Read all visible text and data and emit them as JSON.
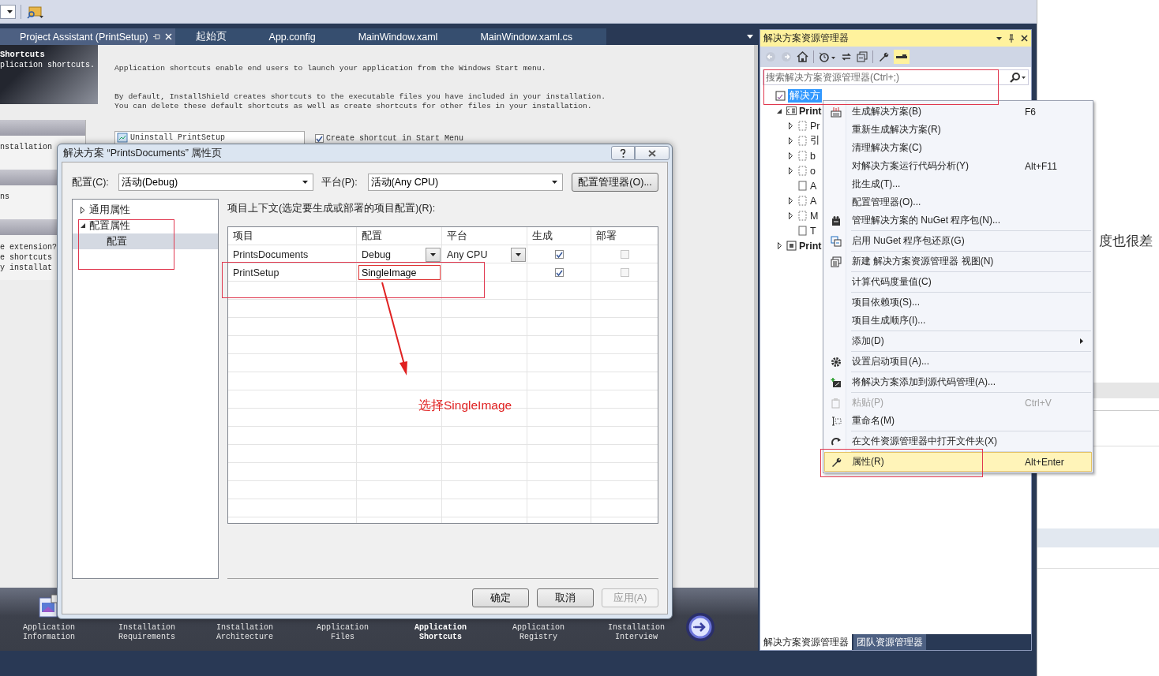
{
  "document_tabs": [
    {
      "label": "Project Assistant (PrintSetup)",
      "selected": true
    },
    {
      "label": "起始页",
      "selected": false
    },
    {
      "label": "App.config",
      "selected": false
    },
    {
      "label": "MainWindow.xaml",
      "selected": false
    },
    {
      "label": "MainWindow.xaml.cs",
      "selected": false
    }
  ],
  "assistant": {
    "sidebar_title": "Shortcuts",
    "sidebar_subtitle": "plication shortcuts.",
    "sidebar_items": [
      "nstallation",
      "ns"
    ],
    "sidebar_lines": [
      "e extension?",
      "e shortcuts",
      "y installat"
    ],
    "intro": "Application shortcuts enable end users to launch your application from the Windows Start menu.",
    "description": [
      "By default, InstallShield creates shortcuts to the executable files you have included in your installation.",
      "You can delete these default shortcuts as well as create shortcuts for other files in your installation."
    ],
    "shortcuts": [
      "Uninstall PrintSetup"
    ],
    "start_menu_option": {
      "label": "Create shortcut in Start Menu",
      "checked": true
    }
  },
  "nav": [
    {
      "label": "Application Information",
      "selected": false
    },
    {
      "label": "Installation Requirements",
      "selected": false
    },
    {
      "label": "Installation Architecture",
      "selected": false
    },
    {
      "label": "Application Files",
      "selected": false
    },
    {
      "label": "Application Shortcuts",
      "selected": true
    },
    {
      "label": "Application Registry",
      "selected": false
    },
    {
      "label": "Installation Interview",
      "selected": false
    }
  ],
  "dialog": {
    "title": "解决方案 “PrintsDocuments” 属性页",
    "config_label": "配置(C):",
    "config_value": "活动(Debug)",
    "platform_label": "平台(P):",
    "platform_value": "活动(Any CPU)",
    "manager_button": "配置管理器(O)...",
    "tree": [
      {
        "label": "通用属性",
        "expanded": false,
        "selected": false
      },
      {
        "label": "配置属性",
        "expanded": true,
        "selected": false,
        "children": [
          {
            "label": "配置",
            "selected": true
          }
        ]
      }
    ],
    "context_label": "项目上下文(选定要生成或部署的项目配置)(R):",
    "columns": [
      "项目",
      "配置",
      "平台",
      "生成",
      "部署"
    ],
    "rows": [
      {
        "project": "PrintsDocuments",
        "configuration": "Debug",
        "editing": false,
        "platform": "Any CPU",
        "build": true,
        "deploy": false
      },
      {
        "project": "PrintSetup",
        "configuration": "SingleImage",
        "editing": true,
        "build": true,
        "deploy": false
      }
    ],
    "buttons": [
      {
        "label": "确定",
        "disabled": false
      },
      {
        "label": "取消",
        "disabled": false
      },
      {
        "label": "应用(A)",
        "disabled": true
      }
    ]
  },
  "solution_explorer": {
    "title": "解决方案资源管理器",
    "search_placeholder": "搜索解决方案资源管理器(Ctrl+;)",
    "tree": [
      {
        "label": "解决方",
        "kind": "solution",
        "selected": true,
        "children": [
          {
            "label": "Print",
            "kind": "project",
            "selected": false,
            "expanded": true,
            "children": [
              {
                "label": "Pr",
                "kind": "group",
                "selected": false,
                "expanded": false
              },
              {
                "label": "引",
                "kind": "group",
                "selected": false,
                "expanded": false
              },
              {
                "label": "b",
                "kind": "group",
                "selected": false,
                "expanded": false
              },
              {
                "label": "o",
                "kind": "group",
                "selected": false,
                "expanded": false
              },
              {
                "label": "A",
                "kind": "leaf",
                "selected": false
              },
              {
                "label": "A",
                "kind": "group",
                "selected": false,
                "expanded": false
              },
              {
                "label": "M",
                "kind": "group",
                "selected": false,
                "expanded": false
              },
              {
                "label": "T",
                "kind": "leaf",
                "selected": false
              }
            ]
          },
          {
            "label": "Print",
            "kind": "project",
            "selected": false,
            "expanded": false
          }
        ]
      }
    ],
    "bottom_tabs": [
      {
        "label": "解决方案资源管理器",
        "selected": true
      },
      {
        "label": "团队资源管理器",
        "selected": false
      }
    ]
  },
  "context_menu": [
    {
      "kind": "item",
      "label": "生成解决方案(B)",
      "shortcut": "F6",
      "disabled": false,
      "selected": false
    },
    {
      "kind": "item",
      "label": "重新生成解决方案(R)",
      "disabled": false,
      "selected": false
    },
    {
      "kind": "item",
      "label": "清理解决方案(C)",
      "disabled": false,
      "selected": false
    },
    {
      "kind": "item",
      "label": "对解决方案运行代码分析(Y)",
      "shortcut": "Alt+F11",
      "disabled": false,
      "selected": false
    },
    {
      "kind": "item",
      "label": "批生成(T)...",
      "disabled": false,
      "selected": false
    },
    {
      "kind": "item",
      "label": "配置管理器(O)...",
      "disabled": false,
      "selected": false
    },
    {
      "kind": "item",
      "label": "管理解决方案的 NuGet 程序包(N)...",
      "disabled": false,
      "selected": false
    },
    {
      "kind": "separator"
    },
    {
      "kind": "item",
      "label": "启用 NuGet 程序包还原(G)",
      "disabled": false,
      "selected": false
    },
    {
      "kind": "separator"
    },
    {
      "kind": "item",
      "label": "新建 解决方案资源管理器 视图(N)",
      "disabled": false,
      "selected": false
    },
    {
      "kind": "separator"
    },
    {
      "kind": "item",
      "label": "计算代码度量值(C)",
      "disabled": false,
      "selected": false
    },
    {
      "kind": "separator"
    },
    {
      "kind": "item",
      "label": "项目依赖项(S)...",
      "disabled": false,
      "selected": false
    },
    {
      "kind": "item",
      "label": "项目生成顺序(I)...",
      "disabled": false,
      "selected": false
    },
    {
      "kind": "separator"
    },
    {
      "kind": "item",
      "label": "添加(D)",
      "submenu": true,
      "disabled": false,
      "selected": false
    },
    {
      "kind": "separator"
    },
    {
      "kind": "item",
      "label": "设置启动项目(A)...",
      "disabled": false,
      "selected": false
    },
    {
      "kind": "separator"
    },
    {
      "kind": "item",
      "label": "将解决方案添加到源代码管理(A)...",
      "disabled": false,
      "selected": false
    },
    {
      "kind": "separator"
    },
    {
      "kind": "item",
      "label": "粘贴(P)",
      "shortcut": "Ctrl+V",
      "disabled": true,
      "selected": false
    },
    {
      "kind": "item",
      "label": "重命名(M)",
      "disabled": false,
      "selected": false
    },
    {
      "kind": "separator"
    },
    {
      "kind": "item",
      "label": "在文件资源管理器中打开文件夹(X)",
      "disabled": false,
      "selected": false
    },
    {
      "kind": "separator"
    },
    {
      "kind": "item",
      "label": "属性(R)",
      "shortcut": "Alt+Enter",
      "disabled": false,
      "selected": true
    }
  ],
  "annotation": {
    "text": "选择SingleImage"
  },
  "background_text": "度也很差"
}
